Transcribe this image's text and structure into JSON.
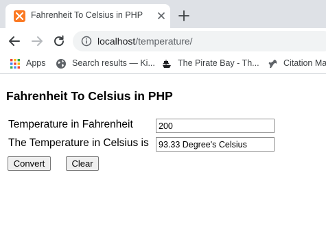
{
  "browser": {
    "tab": {
      "title": "Fahrenheit To Celsius in PHP",
      "favicon": "xampp-icon"
    },
    "address": {
      "host": "localhost",
      "path": "/temperature/"
    },
    "bookmarks": [
      {
        "label": "Apps",
        "icon": "apps-grid-icon"
      },
      {
        "label": "Search results — Ki...",
        "icon": "globe-icon"
      },
      {
        "label": "The Pirate Bay - Th...",
        "icon": "pirate-ship-icon"
      },
      {
        "label": "Citation Ma",
        "icon": "squirrel-icon"
      }
    ]
  },
  "form": {
    "heading": "Fahrenheit To Celsius in PHP",
    "fahrenheit_label": "Temperature in Fahrenheit",
    "fahrenheit_value": "200",
    "celsius_label": "The Temperature in Celsius is",
    "celsius_value": "93.33 Degree's Celsius",
    "convert_label": "Convert",
    "clear_label": "Clear"
  },
  "colors": {
    "tabstrip": "#dee1e6",
    "omnibox": "#f1f3f4",
    "favicon": "#fb7a24"
  }
}
